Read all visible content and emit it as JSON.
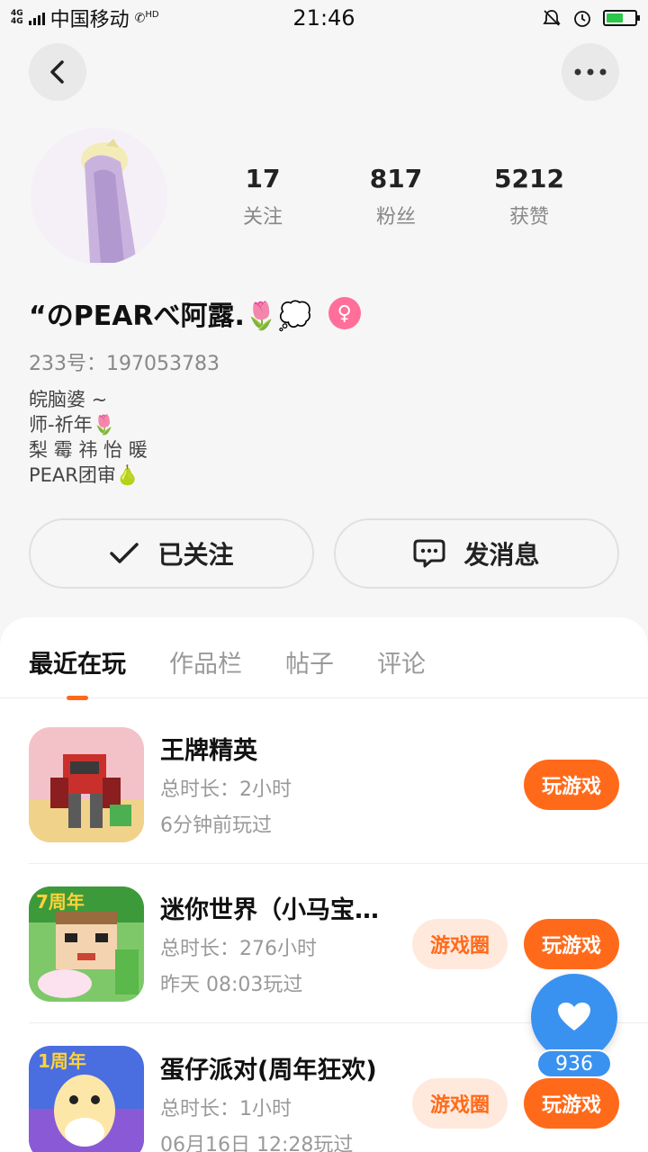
{
  "status_bar": {
    "network": [
      "4G",
      "4G"
    ],
    "carrier": "中国移动",
    "hd": "HD",
    "time": "21:46"
  },
  "profile": {
    "stats": [
      {
        "value": "17",
        "label": "关注"
      },
      {
        "value": "817",
        "label": "粉丝"
      },
      {
        "value": "5212",
        "label": "获赞"
      }
    ],
    "nickname": "“のPEARべ阿露.🌷💭",
    "gender_symbol": "♀",
    "account_id": "233号：197053783",
    "bio": [
      "皖脑婆 ~",
      "师-祈年🌷",
      "梨 霉 祎 怡 暖",
      "PEAR团审🍐"
    ]
  },
  "actions": {
    "follow_label": "已关注",
    "message_label": "发消息"
  },
  "tabs": [
    "最近在玩",
    "作品栏",
    "帖子",
    "评论"
  ],
  "games": [
    {
      "title": "王牌精英",
      "duration": "总时长：2小时",
      "last_played": "6分钟前玩过",
      "has_circle": false
    },
    {
      "title": "迷你世界（小马宝莉联动）",
      "duration": "总时长：276小时",
      "last_played": "昨天 08:03玩过",
      "has_circle": true,
      "badge": "7周年"
    },
    {
      "title": "蛋仔派对(周年狂欢)",
      "duration": "总时长：1小时",
      "last_played": "06月16日 12:28玩过",
      "has_circle": true,
      "badge": "1周年"
    }
  ],
  "buttons": {
    "circle_label": "游戏圈",
    "play_label": "玩游戏"
  },
  "like": {
    "count": "936"
  },
  "colors": {
    "accent": "#ff6a1a",
    "like": "#3a92f0",
    "gender": "#ff6f9a"
  }
}
